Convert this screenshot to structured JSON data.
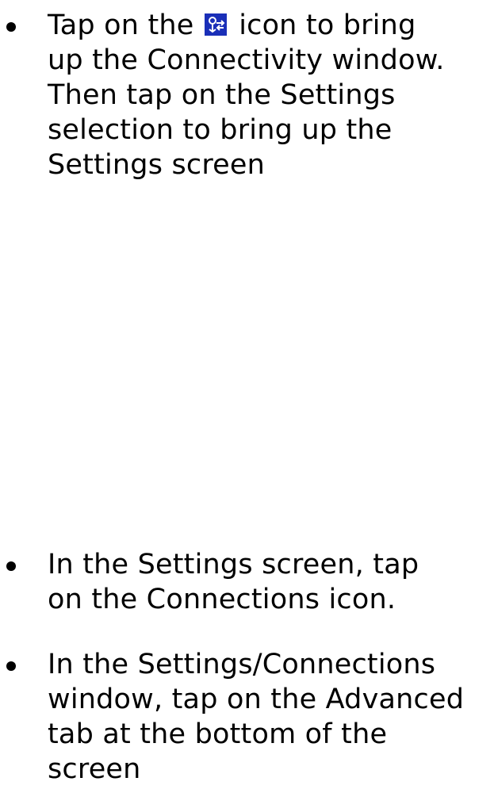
{
  "instructions": [
    {
      "lines": [
        {
          "before_icon": "Tap on the",
          "icon": "connectivity-icon",
          "after_icon": "icon to bring"
        },
        {
          "text": "up the Connectivity window."
        },
        {
          "text": "Then tap on the Settings"
        },
        {
          "text": "selection to bring up the"
        },
        {
          "text": "Settings screen"
        }
      ]
    },
    {
      "lines": [
        {
          "text": "In the Settings screen, tap"
        },
        {
          "text": "on the Connections icon."
        }
      ]
    },
    {
      "lines": [
        {
          "text": "In the Settings/Connections"
        },
        {
          "text": "window, tap on the Advanced"
        },
        {
          "text": "tab at the bottom of the"
        },
        {
          "text": "screen"
        }
      ]
    }
  ],
  "colors": {
    "text": "#000000",
    "background": "#ffffff",
    "icon_background": "#1a2fb8",
    "icon_foreground": "#ffffff"
  }
}
